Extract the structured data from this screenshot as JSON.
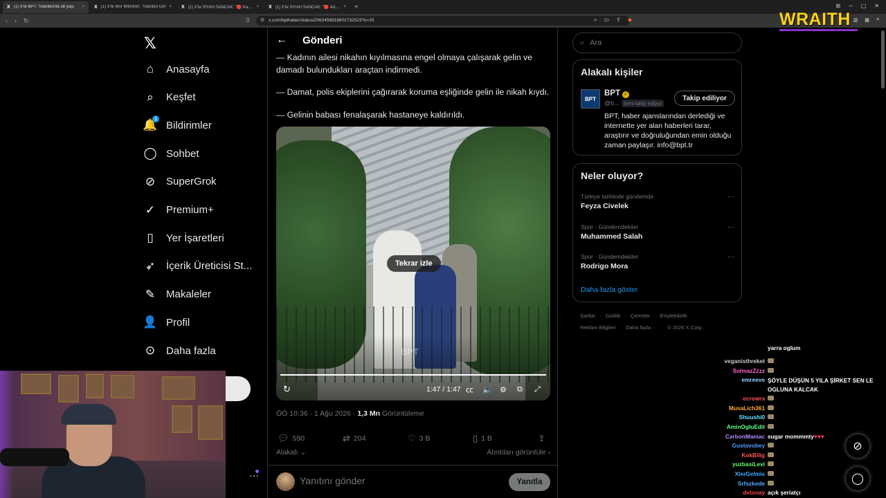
{
  "browser": {
    "tabs": [
      {
        "title": "(1) X'te BPT: \"İstanbul'da 38 yaşı",
        "active": true
      },
      {
        "title": "(1) X'te Mor Mikrofon: \"İstanbul Gör",
        "active": false
      },
      {
        "title": "(1) X'te SİYAH SANCAK: \"🔴 Kahram",
        "active": false
      },
      {
        "title": "(1) X'te SİYAH SANCAK: \"🔴 Adana",
        "active": false
      }
    ],
    "url": "x.com/bpthaber/status/2063456918601732523?s=20"
  },
  "overlay": {
    "brand": "WRAITH"
  },
  "nav": {
    "items": [
      {
        "name": "home",
        "icon": "home-icon",
        "glyph": "⌂",
        "label": "Anasayfa"
      },
      {
        "name": "explore",
        "icon": "search-icon",
        "glyph": "⌕",
        "label": "Keşfet"
      },
      {
        "name": "notifications",
        "icon": "bell-icon",
        "glyph": "🔔",
        "label": "Bildirimler",
        "badge": "1"
      },
      {
        "name": "chat",
        "icon": "chat-icon",
        "glyph": "◯",
        "label": "Sohbet"
      },
      {
        "name": "supergrok",
        "icon": "grok-icon",
        "glyph": "⊘",
        "label": "SuperGrok"
      },
      {
        "name": "premium",
        "icon": "verified-icon",
        "glyph": "✓",
        "label": "Premium+"
      },
      {
        "name": "bookmarks",
        "icon": "bookmark-icon",
        "glyph": "▯",
        "label": "Yer İşaretleri"
      },
      {
        "name": "creator-studio",
        "icon": "rocket-icon",
        "glyph": "➶",
        "label": "İçerik Üreticisi St..."
      },
      {
        "name": "articles",
        "icon": "article-icon",
        "glyph": "✎",
        "label": "Makaleler"
      },
      {
        "name": "profile",
        "icon": "person-icon",
        "glyph": "👤",
        "label": "Profil"
      },
      {
        "name": "more",
        "icon": "more-circle-icon",
        "glyph": "⊙",
        "label": "Daha fazla"
      }
    ]
  },
  "post": {
    "header_title": "Gönderi",
    "paragraphs": [
      "— Kadının ailesi nikahın kıyılmasına engel olmaya çalışarak gelin ve damadı bulundukları araçtan indirmedi.",
      "— Damat, polis ekiplerini çağırarak koruma eşliğinde gelin ile nikah kıydı.",
      "— Gelinin babası fenalaşarak hastaneye kaldırıldı."
    ],
    "video": {
      "replay_label": "Tekrar izle",
      "time": "1:47 / 1:47",
      "watermark": "BPT"
    },
    "time": "ÖÖ 10:36 · 1 Ağu 2026 · ",
    "views_count": "1,3 Mn",
    "views_label": " Görüntüleme",
    "stats": {
      "replies": "590",
      "reposts": "204",
      "likes": "3 B",
      "bookmarks": "1 B"
    },
    "relevance_label": "Alakalı",
    "quotes_label": "Alıntıları görüntüle",
    "reply_placeholder": "Yanıtını gönder",
    "reply_button": "Yanıtla"
  },
  "sidebar": {
    "search_placeholder": "Ara",
    "related": {
      "title": "Alakalı kişiler",
      "name": "BPT",
      "logo_text": "BPT",
      "handle": "@b...",
      "follows_you": "Seni takip ediyor",
      "follow_button": "Takip ediliyor",
      "bio": "BPT, haber ajanslarından derlediği ve internette yer alan haberleri tarar, araştırır ve doğruluğundan emin olduğu zaman paylaşır. info@bpt.tr"
    },
    "trends": {
      "title": "Neler oluyor?",
      "items": [
        {
          "context": "Türkiye tarihinde gündemde",
          "name": "Feyza Civelek"
        },
        {
          "context": "Spor · Gündemdekiler",
          "name": "Muhammed Salah"
        },
        {
          "context": "Spor · Gündemdekiler",
          "name": "Rodrigo Mora"
        }
      ],
      "show_more": "Daha fazla göster"
    },
    "footer": {
      "line1": [
        "Şartlar",
        "Gizlilik",
        "Çerezler",
        "Erişilebilirlik"
      ],
      "line2": [
        "Reklam Bilgileri",
        "Daha fazla ···",
        "© 2026 X Corp."
      ]
    }
  },
  "chat": {
    "lines": [
      {
        "user": "",
        "msg": "yarra oglum",
        "color": "#ffffff"
      },
      {
        "user": "veganisthreket",
        "msg": "",
        "color": "#c7c7c7",
        "emote": true
      },
      {
        "user": "SolmazZzzz",
        "msg": "",
        "color": "#ff66cc",
        "emote": true
      },
      {
        "user": "emreeve",
        "msg": "ŞÖYLE DÜŞÜN 5 YILA ŞİRKET SEN LE OGLUNA KALCAK",
        "color": "#8fd3ff"
      },
      {
        "user": "ecrowra",
        "msg": "",
        "color": "#ff5555",
        "emote": true
      },
      {
        "user": "MusaLich361",
        "msg": "",
        "color": "#ffaa33",
        "emote": true
      },
      {
        "user": "Shuushi0",
        "msg": "",
        "color": "#66e0ff",
        "emote": true
      },
      {
        "user": "AminOgluEdit",
        "msg": "",
        "color": "#66ff88",
        "emote": true
      },
      {
        "user": "CarbonManiac",
        "msg": "sugar mommmty",
        "color": "#b48cff",
        "hearts": "♥♥♥"
      },
      {
        "user": "Gustavobey",
        "msg": "",
        "color": "#5599ff",
        "emote": true
      },
      {
        "user": "KokBilig",
        "msg": "",
        "color": "#ff5555",
        "emote": true
      },
      {
        "user": "yuzbasiLevi",
        "msg": "",
        "color": "#66ff66",
        "emote": true
      },
      {
        "user": "XlerGelmis",
        "msg": "",
        "color": "#3fa9ff",
        "emote": true
      },
      {
        "user": "Srfszkede",
        "msg": "",
        "color": "#55aaff",
        "emote": true
      },
      {
        "user": "dvtonay",
        "msg": "açık şeriatçı",
        "color": "#ff4444"
      }
    ]
  }
}
